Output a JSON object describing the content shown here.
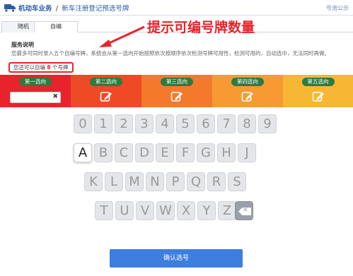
{
  "header": {
    "title": "机动车业务",
    "separator": "/",
    "subtitle": "新车注册登记预选号牌",
    "notice": "号池公示"
  },
  "tabs": [
    {
      "label": "随机"
    },
    {
      "label": "自编"
    }
  ],
  "annotation": {
    "text": "提示可编号牌数量",
    "color": "#e8232b"
  },
  "service": {
    "title": "服务说明",
    "description": "您最多可同时录入五个自编号牌，系统会从第一选向开始按照依次按顺序依次检测号牌可用性，检测可用的，自动选中，无法同时再做。",
    "quota_prefix": "您还可以自编",
    "quota_count": "8",
    "quota_suffix": "个号牌"
  },
  "choices": [
    {
      "label": "第一选向",
      "color": "#e8232b",
      "state": "input"
    },
    {
      "label": "第二选向",
      "color": "#ee4a26",
      "state": "edit"
    },
    {
      "label": "第三选向",
      "color": "#f47a2b",
      "state": "edit"
    },
    {
      "label": "第四选向",
      "color": "#f79a34",
      "state": "edit"
    },
    {
      "label": "第五选向",
      "color": "#f7b733",
      "state": "edit"
    }
  ],
  "keyboard": {
    "row1": [
      "0",
      "1",
      "2",
      "3",
      "4",
      "5",
      "6",
      "7",
      "8",
      "9"
    ],
    "row2": [
      "A",
      "B",
      "C",
      "D",
      "E",
      "F",
      "G",
      "H",
      "J"
    ],
    "row3": [
      "K",
      "L",
      "M",
      "N",
      "P",
      "Q",
      "R",
      "S"
    ],
    "row4": [
      "T",
      "U",
      "V",
      "W",
      "X",
      "Y",
      "Z"
    ],
    "active_key": "A",
    "delete_icon": "backspace-icon"
  },
  "confirm": {
    "label": "确认选号"
  }
}
